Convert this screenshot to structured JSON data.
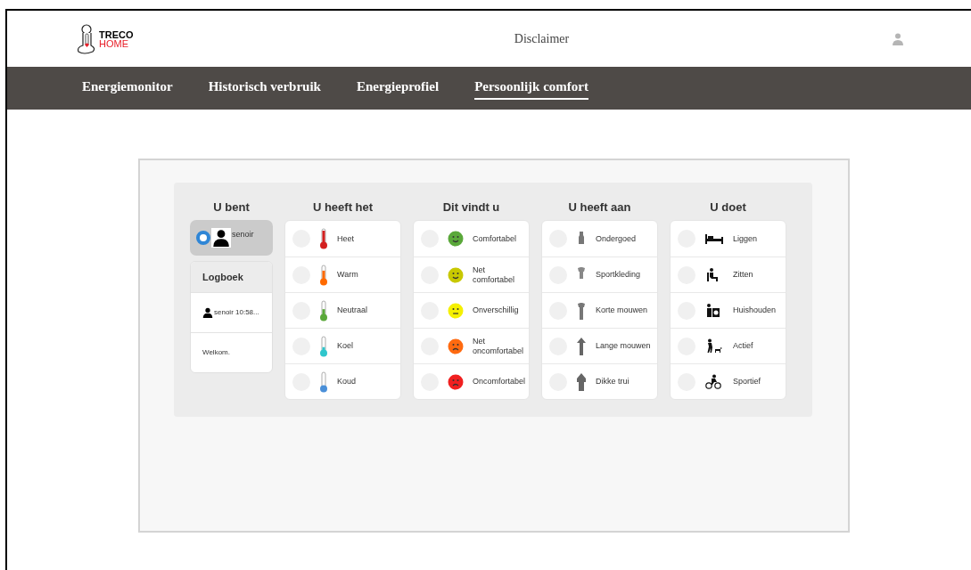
{
  "header": {
    "logo": {
      "line1": "TRECO",
      "line2": "HOME"
    },
    "link": "Disclaimer"
  },
  "nav": [
    {
      "label": "Energiemonitor",
      "selected": false
    },
    {
      "label": "Historisch verbruik",
      "selected": false
    },
    {
      "label": "Energieprofiel",
      "selected": false
    },
    {
      "label": "Persoonlijk comfort",
      "selected": true
    }
  ],
  "profile": {
    "heading": "U bent",
    "user": {
      "label": "senoir",
      "selected": true
    }
  },
  "logbook": {
    "title": "Logboek",
    "entries": [
      {
        "kind": "user",
        "text": "senoir 10:58..."
      },
      {
        "kind": "message",
        "text": "Welkom."
      }
    ]
  },
  "columns": [
    {
      "heading": "U heeft het",
      "kind": "temperature",
      "options": [
        {
          "label": "Heet",
          "selected": false,
          "color": "#d32020"
        },
        {
          "label": "Warm",
          "selected": false,
          "color": "#ff6a00"
        },
        {
          "label": "Neutraal",
          "selected": false,
          "color": "#5aa83a"
        },
        {
          "label": "Koel",
          "selected": false,
          "color": "#2fc6cc"
        },
        {
          "label": "Koud",
          "selected": false,
          "color": "#4a8fd8"
        }
      ]
    },
    {
      "heading": "Dit vindt u",
      "kind": "mood",
      "options": [
        {
          "label": "Comfortabel",
          "selected": false,
          "color": "#5aa83a"
        },
        {
          "label": "Net comfortabel",
          "selected": false,
          "color": "#c8c800"
        },
        {
          "label": "Onverschillig",
          "selected": false,
          "color": "#f5f000"
        },
        {
          "label": "Net oncomfortabel",
          "selected": false,
          "color": "#ff6a10"
        },
        {
          "label": "Oncomfortabel",
          "selected": false,
          "color": "#f02020"
        }
      ]
    },
    {
      "heading": "U heeft aan",
      "kind": "clothing",
      "options": [
        {
          "label": "Ondergoed",
          "selected": false
        },
        {
          "label": "Sportkleding",
          "selected": false
        },
        {
          "label": "Korte mouwen",
          "selected": false
        },
        {
          "label": "Lange mouwen",
          "selected": false
        },
        {
          "label": "Dikke trui",
          "selected": false
        }
      ]
    },
    {
      "heading": "U doet",
      "kind": "activity",
      "options": [
        {
          "label": "Liggen",
          "selected": false
        },
        {
          "label": "Zitten",
          "selected": false
        },
        {
          "label": "Huishouden",
          "selected": false
        },
        {
          "label": "Actief",
          "selected": false
        },
        {
          "label": "Sportief",
          "selected": false
        }
      ]
    }
  ]
}
